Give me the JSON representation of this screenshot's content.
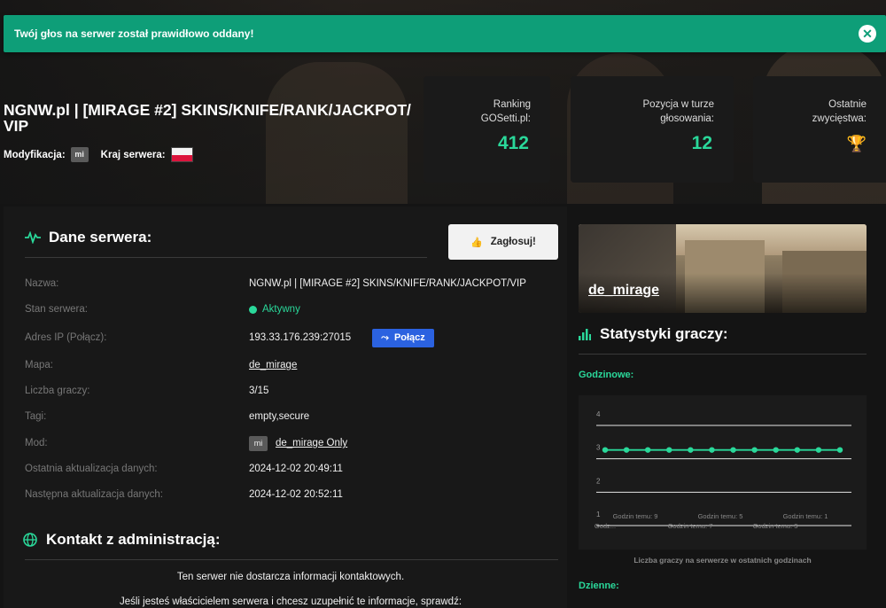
{
  "alert": {
    "message": "Twój głos na serwer został prawidłowo oddany!",
    "close_icon": "✕"
  },
  "server": {
    "title": "NGNW.pl | [MIRAGE #2] SKINS/KNIFE/RANK/JACKPOT/ VIP",
    "mod_label": "Modyfikacja:",
    "mod_badge": "mi",
    "country_label": "Kraj serwera:",
    "country_flag": "PL"
  },
  "stats": [
    {
      "label_line1": "Ranking",
      "label_line2": "GOSetti.pl:",
      "value": "412"
    },
    {
      "label_line1": "Pozycja w turze",
      "label_line2": "głosowania:",
      "value": "12"
    },
    {
      "label_line1": "Ostatnie",
      "label_line2": "zwycięstwa:",
      "icon": "trophy-icon"
    }
  ],
  "server_data": {
    "heading": "Dane serwera:",
    "vote_button": "Zagłosuj!",
    "rows": {
      "name": {
        "label": "Nazwa:",
        "value": "NGNW.pl | [MIRAGE #2] SKINS/KNIFE/RANK/JACKPOT/VIP"
      },
      "status": {
        "label": "Stan serwera:",
        "value": "Aktywny"
      },
      "ip": {
        "label": "Adres IP (Połącz):",
        "value": "193.33.176.239:27015",
        "connect_button": "Połącz"
      },
      "map": {
        "label": "Mapa:",
        "value": "de_mirage"
      },
      "players": {
        "label": "Liczba graczy:",
        "value": "3/15"
      },
      "tags": {
        "label": "Tagi:",
        "value": "empty,secure"
      },
      "mod": {
        "label": "Mod:",
        "badge": "mi",
        "value": "de_mirage Only"
      },
      "last_update": {
        "label": "Ostatnia aktualizacja danych:",
        "value": "2024-12-02 20:49:11"
      },
      "next_update": {
        "label": "Następna aktualizacja danych:",
        "value": "2024-12-02 20:52:11"
      }
    }
  },
  "contact": {
    "heading": "Kontakt z administracją:",
    "line1": "Ten serwer nie dostarcza informacji kontaktowych.",
    "line2": "Jeśli jesteś właścicielem serwera i chcesz uzupełnić te informacje, sprawdź:"
  },
  "map_card": {
    "name": "de_mirage"
  },
  "player_stats": {
    "heading": "Statystyki graczy:",
    "hourly_label": "Godzinowe:",
    "daily_label": "Dzienne:",
    "caption": "Liczba graczy na serwerze w ostatnich godzinach"
  },
  "colors": {
    "accent": "#2ad89a",
    "alert": "#0e9e78",
    "connect": "#2b62e0",
    "trophy": "#c96a2a"
  },
  "chart_data": {
    "type": "line",
    "title": "",
    "xlabel": "",
    "ylabel": "",
    "x_labels_top": [
      "Godzin temu: 9",
      "Godzin temu: 5",
      "Godzin temu: 1"
    ],
    "x_labels_bottom": [
      "Godz...",
      "Godzin temu: 7",
      "Godzin temu: 3"
    ],
    "y_ticks": [
      "1",
      "2",
      "3",
      "4"
    ],
    "ylim": [
      1,
      4
    ],
    "series": [
      {
        "values": [
          3,
          3,
          3,
          3,
          3,
          3,
          3,
          3,
          3,
          3,
          3,
          3
        ]
      }
    ]
  }
}
